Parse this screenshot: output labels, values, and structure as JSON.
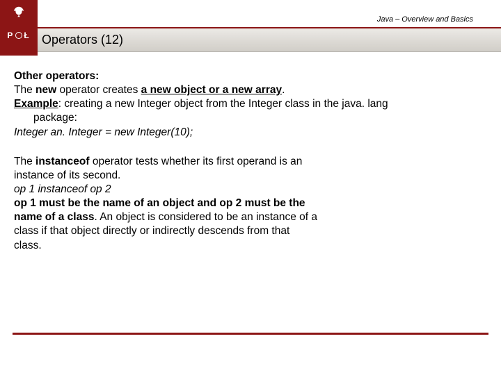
{
  "header": {
    "course_label": "Java – Overview and Basics",
    "logo_letters_left": "P",
    "logo_letters_right": "Ł",
    "slide_title": "Operators (12)"
  },
  "body": {
    "subheading": "Other operators:",
    "p1_a": "The ",
    "p1_b": "new",
    "p1_c": " operator creates ",
    "p1_d": "a new object or a new array",
    "p1_e": ".",
    "p1_ex_label": "Example",
    "p1_ex_rest": ": creating a new Integer object from the Integer class in the java. lang",
    "p1_pkg": "package:",
    "p1_code": "Integer an. Integer = new Integer(10);",
    "p2_a": "The ",
    "p2_b": "instanceof",
    "p2_c": " operator tests whether its first operand is an",
    "p2_line2": "instance of its second.",
    "p2_sig": "op 1 instanceof op 2",
    "p2_rule_a": "op 1 must be the name of an object and op 2 must be the",
    "p2_rule_b": "name of a class",
    "p2_rule_c": ". An object is considered to be an instance of a",
    "p2_tail1": " class if that object directly or indirectly descends from that",
    "p2_tail2": " class."
  }
}
